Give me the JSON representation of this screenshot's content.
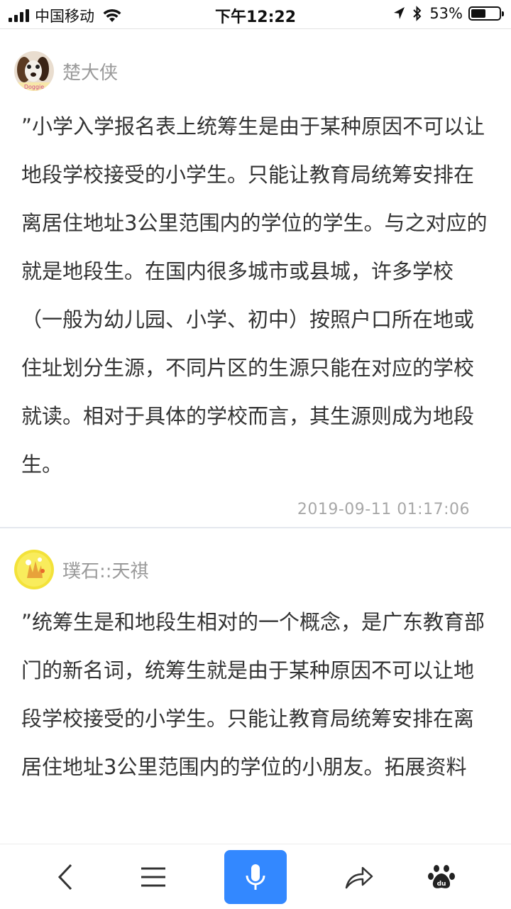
{
  "status_bar": {
    "carrier": "中国移动",
    "time": "下午12:22",
    "battery_percent": "53%",
    "battery_level": 0.53
  },
  "answers": [
    {
      "username": "楚大侠",
      "content": "”小学入学报名表上统筹生是由于某种原因不可以让地段学校接受的小学生。只能让教育局统筹安排在离居住地址3公里范围内的学位的学生。与之对应的就是地段生。在国内很多城市或县城，许多学校（一般为幼儿园、小学、初中）按照户口所在地或住址划分生源，不同片区的生源只能在对应的学校就读。相对于具体的学校而言，其生源则成为地段生。",
      "timestamp": "2019-09-11 01:17:06"
    },
    {
      "username": "璞石::天祺",
      "content": "”统筹生是和地段生相对的一个概念，是广东教育部门的新名词，统筹生就是由于某种原因不可以让地段学校接受的小学生。只能让教育局统筹安排在离居住地址3公里范围内的学位的小朋友。拓展资料"
    }
  ],
  "toolbar": {
    "icons": [
      "back-icon",
      "menu-icon",
      "microphone-icon",
      "share-icon",
      "baidu-paw-icon"
    ],
    "accent_color": "#3388ff"
  }
}
